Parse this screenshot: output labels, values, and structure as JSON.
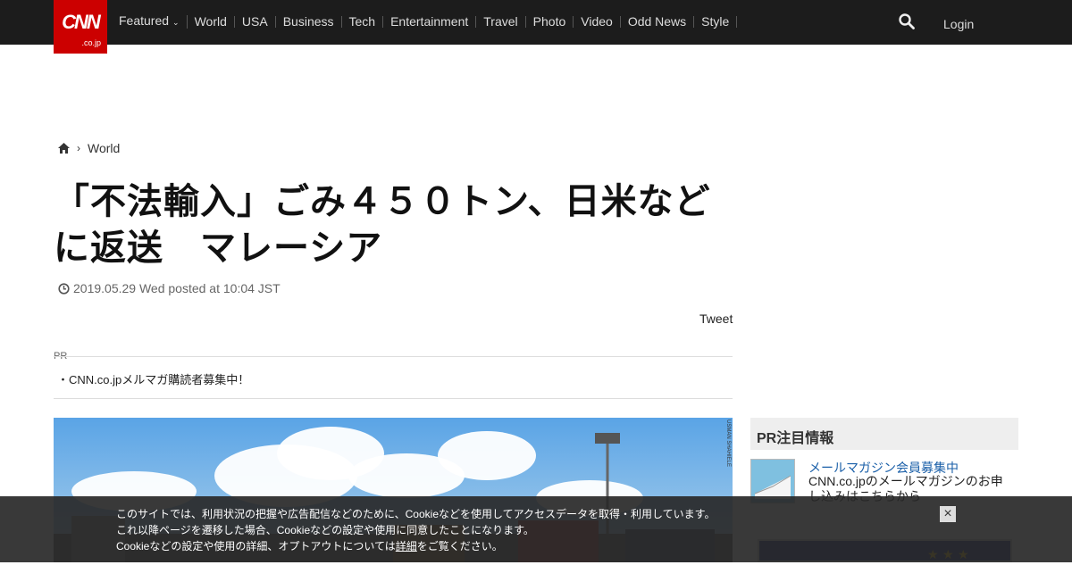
{
  "header": {
    "logo_main": "CNN",
    "logo_sub": ".co.jp",
    "nav": [
      "Featured",
      "World",
      "USA",
      "Business",
      "Tech",
      "Entertainment",
      "Travel",
      "Photo",
      "Video",
      "Odd News",
      "Style"
    ],
    "login": "Login"
  },
  "breadcrumb": {
    "section": "World"
  },
  "article": {
    "title_line1": "「不法輸入」ごみ４５０トン、日米など",
    "title_line2": "に返送　マレーシア",
    "date": "2019.05.29 Wed posted at 10:04 JST",
    "tweet": "Tweet",
    "pr_label": "PR",
    "pr_link": "・CNN.co.jpメルマガ購読者募集中！",
    "photo_credit": "USMAN SHAHIELE"
  },
  "sidebar": {
    "heading": "PR注目情報",
    "item_title": "メールマガジン会員募集中",
    "item_desc": "CNN.co.jpのメールマガジンのお申し込みはこちらから"
  },
  "cookie": {
    "line1": "このサイトでは、利用状況の把握や広告配信などのために、Cookieなどを使用してアクセスデータを取得・利用しています。",
    "line2": "これ以降ページを遷移した場合、Cookieなどの設定や使用に同意したことになります。",
    "line3_pre": "Cookieなどの設定や使用の詳細、オプトアウトについては",
    "line3_link": "詳細",
    "line3_post": "をご覧ください。",
    "close": "×"
  },
  "colors": {
    "topbar": "#1c1c1c",
    "brand_red": "#cc0000",
    "link_blue": "#1a5fa8"
  }
}
